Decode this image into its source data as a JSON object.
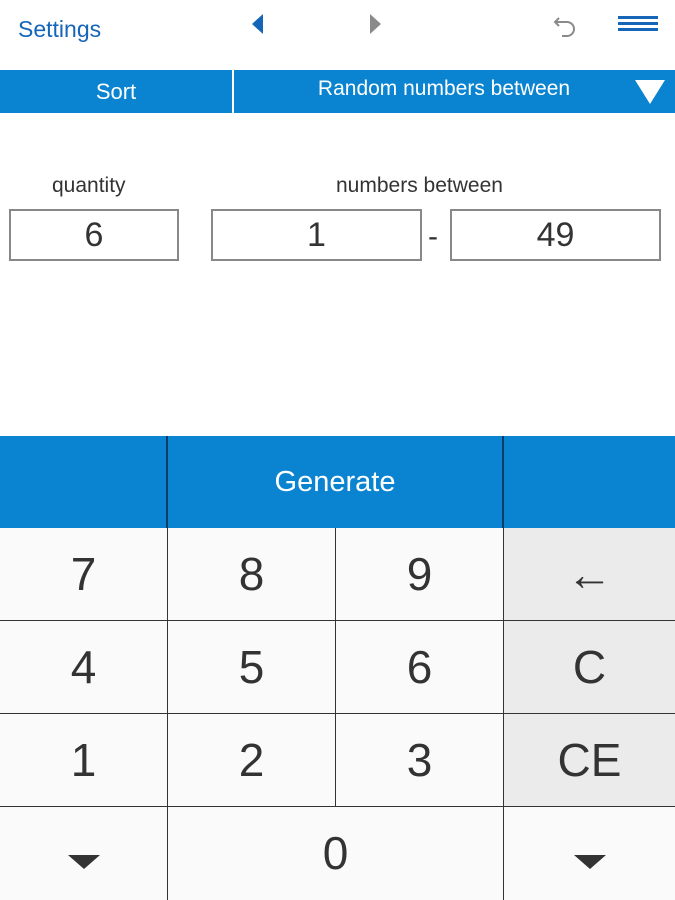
{
  "topbar": {
    "settings_label": "Settings",
    "icons": [
      "arrow-left-icon",
      "arrow-right-icon",
      "undo-icon",
      "menu-icon"
    ]
  },
  "mode_bar": {
    "sort_label": "Sort",
    "mode_label": "Random numbers between"
  },
  "form": {
    "quantity_label": "quantity",
    "quantity_value": "6",
    "range_label": "numbers between",
    "range_min": "1",
    "range_separator": "-",
    "range_max": "49"
  },
  "generate_label": "Generate",
  "keypad": {
    "k7": "7",
    "k8": "8",
    "k9": "9",
    "backspace": "←",
    "k4": "4",
    "k5": "5",
    "k6": "6",
    "clear": "C",
    "k1": "1",
    "k2": "2",
    "k3": "3",
    "clear_entry": "CE",
    "k0": "0"
  },
  "colors": {
    "accent": "#0a84d0",
    "link": "#1565b8"
  }
}
